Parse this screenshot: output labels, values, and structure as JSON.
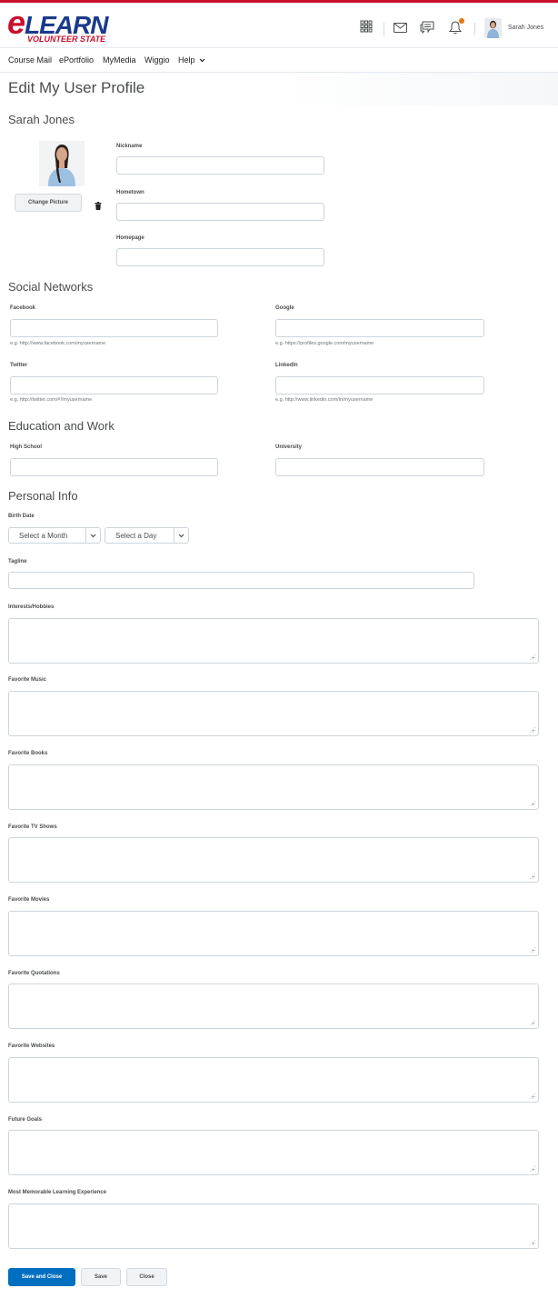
{
  "header": {
    "logo_main": "LEARN",
    "logo_e": "e",
    "logo_sub": "VOLUNTEER STATE",
    "user_name": "Sarah Jones",
    "icons": [
      "waffle-grid-icon",
      "mail-icon",
      "chat-icon",
      "bell-icon"
    ],
    "accent_color": "#c8102e"
  },
  "nav": {
    "items": [
      {
        "label": "Course Mail"
      },
      {
        "label": "ePortfolio"
      },
      {
        "label": "MyMedia"
      },
      {
        "label": "Wiggio"
      },
      {
        "label": "Help"
      }
    ]
  },
  "page": {
    "title": "Edit My User Profile",
    "user_name": "Sarah Jones"
  },
  "profile": {
    "change_picture_label": "Change Picture",
    "nickname_label": "Nickname",
    "hometown_label": "Hometown",
    "homepage_label": "Homepage"
  },
  "social": {
    "heading": "Social Networks",
    "facebook_label": "Facebook",
    "facebook_hint": "e.g. http://www.facebook.com/myusername",
    "google_label": "Google",
    "google_hint": "e.g. https://profiles.google.com/myusername",
    "twitter_label": "Twitter",
    "twitter_hint": "e.g. http://twitter.com/#!/myusername",
    "linkedin_label": "LinkedIn",
    "linkedin_hint": "e.g. http://www.linkedin.com/in/myusername"
  },
  "education": {
    "heading": "Education and Work",
    "high_school_label": "High School",
    "university_label": "University"
  },
  "personal": {
    "heading": "Personal Info",
    "birth_date_label": "Birth Date",
    "month_select": "Select a Month",
    "day_select": "Select a Day",
    "tagline_label": "Tagline",
    "textareas": [
      "Interests/Hobbies",
      "Favorite Music",
      "Favorite Books",
      "Favorite TV Shows",
      "Favorite Movies",
      "Favorite Quotations",
      "Favorite Websites",
      "Future Goals",
      "Most Memorable Learning Experience"
    ]
  },
  "actions": {
    "save_close_label": "Save and Close",
    "save_label": "Save",
    "close_label": "Close",
    "primary_color": "#006fbf"
  }
}
